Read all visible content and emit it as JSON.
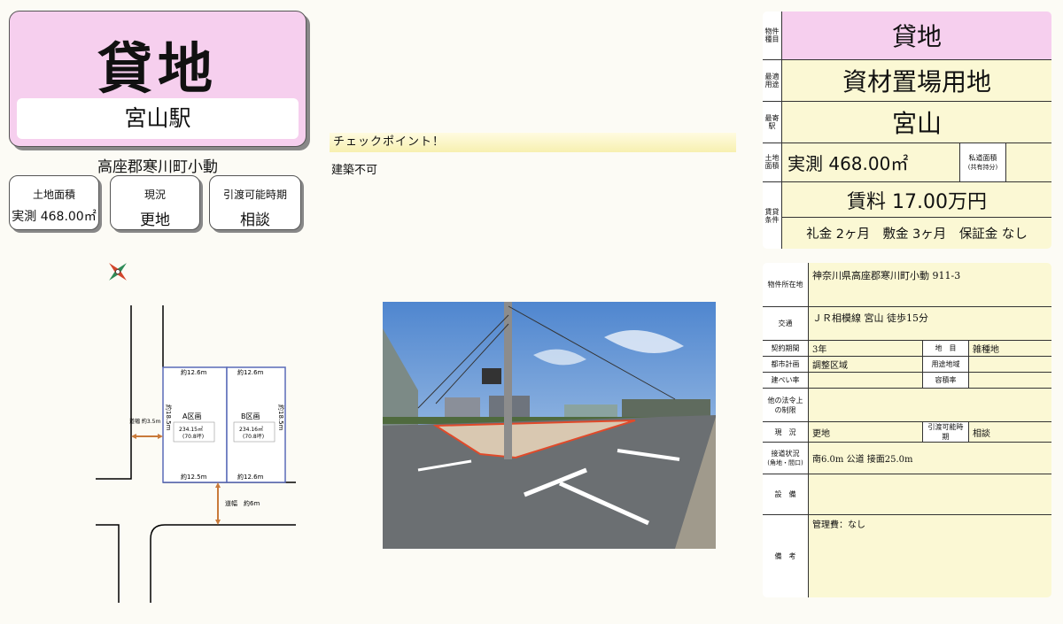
{
  "header": {
    "title": "貸地",
    "station": "宮山駅",
    "address_short": "高座郡寒川町小動"
  },
  "info_cards": [
    {
      "label": "土地面積",
      "value": "実測 468.00㎡"
    },
    {
      "label": "現況",
      "value": "更地"
    },
    {
      "label": "引渡可能時期",
      "value": "相談"
    }
  ],
  "site_map": {
    "lot_a": {
      "name": "A区画",
      "area": "234.15㎡",
      "tsubo": "(70.8坪)"
    },
    "lot_b": {
      "name": "B区画",
      "area": "234.16㎡",
      "tsubo": "(70.8坪)"
    },
    "dims": {
      "a_top": "約12.6m",
      "b_top": "約12.6m",
      "a_bottom": "約12.5m",
      "b_bottom": "約12.6m",
      "a_side": "約18.5m",
      "b_side": "約18.5m"
    },
    "road_west": "道幅 約3.5m",
    "road_south": "道幅　約6m"
  },
  "checkpoint": {
    "heading": "チェックポイント！",
    "text": "建築不可"
  },
  "summary": {
    "type_label": "物件種目",
    "type_value": "貸地",
    "use_label": "最適用途",
    "use_value": "資材置場用地",
    "station_label": "最寄駅",
    "station_value": "宮山",
    "area_label": "土地面積",
    "area_value": "実測 468.00㎡",
    "private_road_label": "私道面積",
    "private_road_sub": "(共有持分)",
    "terms_label": "賃貸条件",
    "rent": "賃料 17.00万円",
    "deposits": "礼金 2ヶ月　敷金 3ヶ月　保証金 なし"
  },
  "details": {
    "location_label": "物件所在地",
    "location_value": "神奈川県高座郡寒川町小動 911-3",
    "transport_label": "交通",
    "transport_value": "ＪＲ相模線 宮山 徒歩15分",
    "contract_label": "契約期間",
    "contract_value": "3年",
    "category_label": "地　目",
    "category_value": "雑種地",
    "city_plan_label": "都市計画",
    "city_plan_value": "調整区域",
    "zoning_label": "用途地域",
    "zoning_value": "",
    "coverage_label": "建ぺい率",
    "coverage_value": "",
    "far_label": "容積率",
    "far_value": "",
    "restrictions_label": "他の法令上の制限",
    "restrictions_value": "",
    "status_label": "現　況",
    "status_value": "更地",
    "handover_label": "引渡可能時期",
    "handover_value": "相談",
    "road_label": "接道状況",
    "road_sub": "(角地・間口)",
    "road_value": "南6.0m 公道 接面25.0m",
    "facilities_label": "設　備",
    "facilities_value": "",
    "remarks_label": "備　考",
    "remarks_value": "管理費：なし"
  },
  "colors": {
    "pink": "#f6cfee",
    "cream": "#fbf8d4",
    "lot_border": "#5a6bb8",
    "arrow": "#c97a3a"
  }
}
